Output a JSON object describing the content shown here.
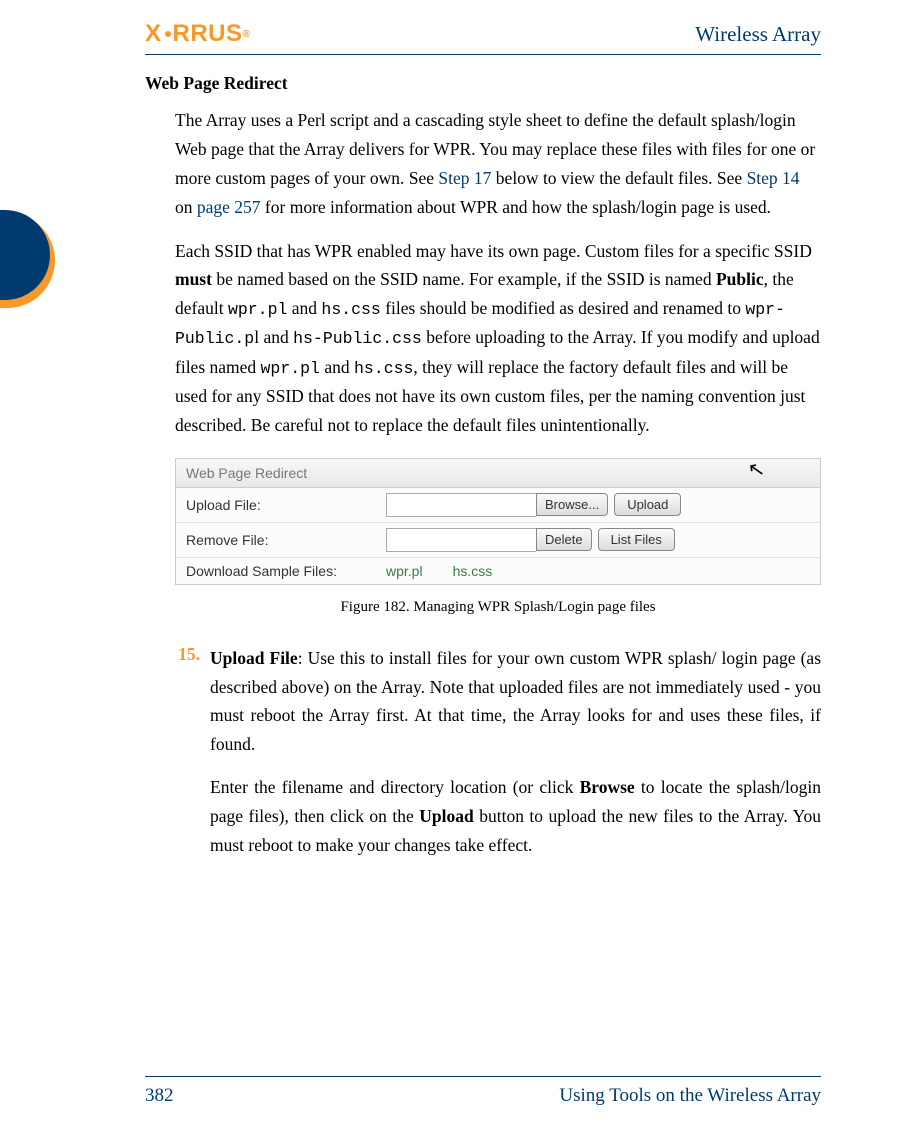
{
  "header": {
    "logo_text": "XIRRUS",
    "right": "Wireless Array"
  },
  "section_title": "Web Page Redirect",
  "para1": {
    "t1": "The Array uses a Perl script and a cascading style sheet to define the default splash/login Web page that the Array delivers for WPR. You may replace these files with files for one or more custom pages of your own. See ",
    "link1": "Step 17",
    "t2": " below to view the default files. See ",
    "link2": "Step 14",
    "t3": " on ",
    "link3": "page 257",
    "t4": " for more information about WPR and how the splash/login page is used."
  },
  "para2": {
    "t1": "Each SSID that has WPR enabled may have its own page. Custom files for a specific SSID ",
    "b1": "must",
    "t2": " be named based on the SSID name. For example, if the SSID is named ",
    "b2": "Public",
    "t3": ", the default ",
    "m1": "wpr.pl",
    "t4": " and ",
    "m2": "hs.css",
    "t5": " files should be modified as desired and renamed to ",
    "m3": "wpr-Public.p",
    "t6": "l and ",
    "m4": "hs-Public.css",
    "t7": " before uploading to the Array. If you modify and upload files named ",
    "m5": "wpr.pl",
    "t8": " and ",
    "m6": "hs.css",
    "t9": ", they will replace the factory default files and will be used for any SSID that does not have its own custom files, per the naming convention just described. Be careful not to replace the default files unintentionally."
  },
  "figure": {
    "header": "Web Page Redirect",
    "row1_label": "Upload File:",
    "row1_browse": "Browse...",
    "row1_upload": "Upload",
    "row2_label": "Remove File:",
    "row2_delete": "Delete",
    "row2_list": "List Files",
    "row3_label": "Download Sample Files:",
    "row3_file1": "wpr.pl",
    "row3_file2": "hs.css"
  },
  "figure_caption": "Figure 182. Managing WPR Splash/Login page files",
  "step15": {
    "num": "15.",
    "title": "Upload File",
    "t1": ": Use this to install files for your own custom WPR splash/ login page (as described above) on the Array. Note that uploaded files are not immediately used - you must reboot the Array first. At that time, the Array looks for and uses these files, if found.",
    "p2a": "Enter the filename and directory location (or click ",
    "p2b1": "Browse",
    "p2b": " to locate the splash/login page files), then click on the ",
    "p2b2": "Upload",
    "p2c": " button to upload the new files to the Array. You must reboot to make your changes take effect."
  },
  "footer": {
    "page": "382",
    "section": "Using Tools on the Wireless Array"
  }
}
